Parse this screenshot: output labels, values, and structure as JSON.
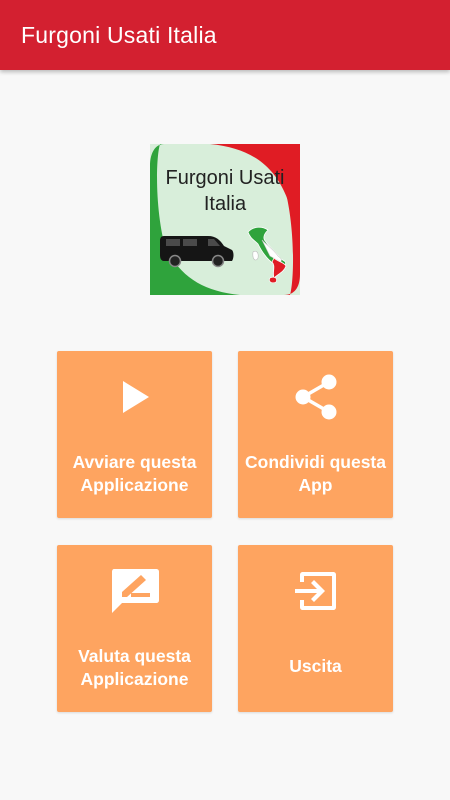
{
  "app_bar": {
    "title": "Furgoni Usati Italia"
  },
  "logo": {
    "line1": "Furgoni Usati",
    "line2": "Italia",
    "colors": {
      "green": "#2fa33c",
      "red": "#e01c24",
      "background": "#d8eeda"
    }
  },
  "tiles": [
    {
      "label_line1": "Avviare questa",
      "label_line2": "Applicazione",
      "icon": "play-icon"
    },
    {
      "label_line1": "Condividi questa",
      "label_line2": "App",
      "icon": "share-icon"
    },
    {
      "label_line1": "Valuta questa",
      "label_line2": "Applicazione",
      "icon": "rate-review-icon"
    },
    {
      "label_line1": "Uscita",
      "icon": "exit-icon"
    }
  ],
  "colors": {
    "app_bar": "#d32030",
    "tile": "#fea460",
    "background": "#f8f8f8"
  }
}
